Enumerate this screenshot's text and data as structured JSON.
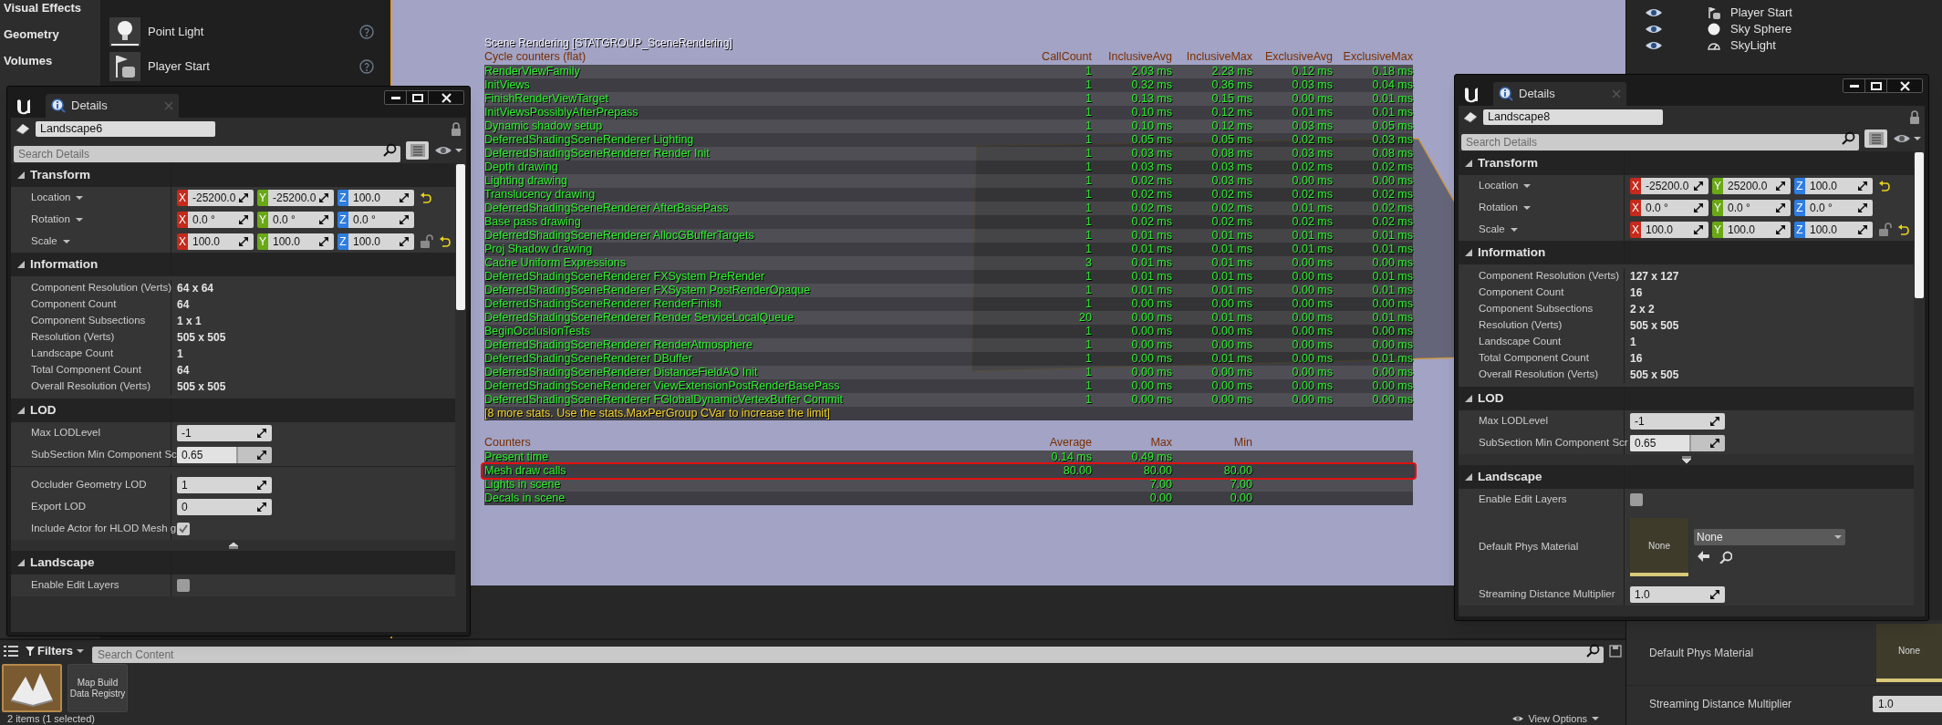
{
  "place_actors": {
    "categories": [
      {
        "label": "Visual Effects"
      },
      {
        "label": "Geometry"
      },
      {
        "label": "Volumes"
      }
    ],
    "items": [
      {
        "label": "Point Light",
        "kind": "light"
      },
      {
        "label": "Player Start",
        "kind": "player_start"
      }
    ]
  },
  "viewport": {
    "stats": {
      "title": "Scene Rendering [STATGROUP_SceneRendering]",
      "cycle_header": "Cycle counters (flat)",
      "cycle_columns": [
        "CallCount",
        "InclusiveAvg",
        "InclusiveMax",
        "ExclusiveAvg",
        "ExclusiveMax"
      ],
      "cycle_rows": [
        {
          "name": "RenderViewFamily",
          "values": [
            "1",
            "2.03 ms",
            "2.23 ms",
            "0.12 ms",
            "0.18 ms"
          ]
        },
        {
          "name": "InitViews",
          "values": [
            "1",
            "0.32 ms",
            "0.36 ms",
            "0.03 ms",
            "0.04 ms"
          ]
        },
        {
          "name": "FinishRenderViewTarget",
          "values": [
            "1",
            "0.13 ms",
            "0.15 ms",
            "0.00 ms",
            "0.01 ms"
          ]
        },
        {
          "name": "InitViewsPossiblyAfterPrepass",
          "values": [
            "1",
            "0.10 ms",
            "0.12 ms",
            "0.01 ms",
            "0.01 ms"
          ]
        },
        {
          "name": "Dynamic shadow setup",
          "values": [
            "1",
            "0.10 ms",
            "0.12 ms",
            "0.03 ms",
            "0.05 ms"
          ]
        },
        {
          "name": "DeferredShadingSceneRenderer Lighting",
          "values": [
            "1",
            "0.05 ms",
            "0.05 ms",
            "0.02 ms",
            "0.03 ms"
          ]
        },
        {
          "name": "DeferredShadingSceneRenderer Render Init",
          "values": [
            "1",
            "0.03 ms",
            "0.08 ms",
            "0.03 ms",
            "0.08 ms"
          ]
        },
        {
          "name": "Depth drawing",
          "values": [
            "1",
            "0.03 ms",
            "0.03 ms",
            "0.02 ms",
            "0.02 ms"
          ]
        },
        {
          "name": "Lighting drawing",
          "values": [
            "1",
            "0.02 ms",
            "0.03 ms",
            "0.00 ms",
            "0.00 ms"
          ]
        },
        {
          "name": "Translucency drawing",
          "values": [
            "1",
            "0.02 ms",
            "0.02 ms",
            "0.02 ms",
            "0.02 ms"
          ]
        },
        {
          "name": "DeferredShadingSceneRenderer AfterBasePass",
          "values": [
            "1",
            "0.02 ms",
            "0.02 ms",
            "0.01 ms",
            "0.02 ms"
          ]
        },
        {
          "name": "Base pass drawing",
          "values": [
            "1",
            "0.02 ms",
            "0.02 ms",
            "0.02 ms",
            "0.02 ms"
          ]
        },
        {
          "name": "DeferredShadingSceneRenderer AllocGBufferTargets",
          "values": [
            "1",
            "0.01 ms",
            "0.01 ms",
            "0.01 ms",
            "0.01 ms"
          ]
        },
        {
          "name": "Proj Shadow drawing",
          "values": [
            "1",
            "0.01 ms",
            "0.01 ms",
            "0.01 ms",
            "0.01 ms"
          ]
        },
        {
          "name": "Cache Uniform Expressions",
          "values": [
            "3",
            "0.01 ms",
            "0.01 ms",
            "0.00 ms",
            "0.00 ms"
          ]
        },
        {
          "name": "DeferredShadingSceneRenderer FXSystem PreRender",
          "values": [
            "1",
            "0.01 ms",
            "0.01 ms",
            "0.00 ms",
            "0.01 ms"
          ]
        },
        {
          "name": "DeferredShadingSceneRenderer FXSystem PostRenderOpaque",
          "values": [
            "1",
            "0.01 ms",
            "0.01 ms",
            "0.00 ms",
            "0.01 ms"
          ]
        },
        {
          "name": "DeferredShadingSceneRenderer RenderFinish",
          "values": [
            "1",
            "0.00 ms",
            "0.00 ms",
            "0.00 ms",
            "0.00 ms"
          ]
        },
        {
          "name": "DeferredShadingSceneRenderer Render ServiceLocalQueue",
          "values": [
            "20",
            "0.00 ms",
            "0.01 ms",
            "0.00 ms",
            "0.01 ms"
          ]
        },
        {
          "name": "BeginOcclusionTests",
          "values": [
            "1",
            "0.00 ms",
            "0.00 ms",
            "0.00 ms",
            "0.00 ms"
          ]
        },
        {
          "name": "DeferredShadingSceneRenderer RenderAtmosphere",
          "values": [
            "1",
            "0.00 ms",
            "0.00 ms",
            "0.00 ms",
            "0.00 ms"
          ]
        },
        {
          "name": "DeferredShadingSceneRenderer DBuffer",
          "values": [
            "1",
            "0.00 ms",
            "0.01 ms",
            "0.00 ms",
            "0.01 ms"
          ]
        },
        {
          "name": "DeferredShadingSceneRenderer DistanceFieldAO Init",
          "values": [
            "1",
            "0.00 ms",
            "0.00 ms",
            "0.00 ms",
            "0.00 ms"
          ]
        },
        {
          "name": "DeferredShadingSceneRenderer ViewExtensionPostRenderBasePass",
          "values": [
            "1",
            "0.00 ms",
            "0.00 ms",
            "0.00 ms",
            "0.00 ms"
          ]
        },
        {
          "name": "DeferredShadingSceneRenderer FGlobalDynamicVertexBuffer Commit",
          "values": [
            "1",
            "0.00 ms",
            "0.00 ms",
            "0.00 ms",
            "0.00 ms"
          ]
        }
      ],
      "more_note": "[8 more stats. Use the stats.MaxPerGroup CVar to increase the limit]",
      "counters_header": "Counters",
      "counter_columns": [
        "Average",
        "Max",
        "Min"
      ],
      "counter_rows": [
        {
          "name": "Present time",
          "average": "0.14 ms",
          "max": "0.49 ms",
          "highlighted": false
        },
        {
          "name": "Mesh draw calls",
          "average": "80.00",
          "max": "80.00",
          "min": "80.00",
          "highlighted": true
        },
        {
          "name": "Lights in scene",
          "max": "7.00",
          "min": "7.00",
          "highlighted": false
        },
        {
          "name": "Decals in scene",
          "max": "0.00",
          "min": "0.00",
          "highlighted": false
        }
      ]
    }
  },
  "details_windows": [
    {
      "tab": "Details",
      "object_name": "Landscape6",
      "search_placeholder": "Search Details",
      "sections": [
        {
          "title": "Transform",
          "expanded": true,
          "rows": [
            {
              "kind": "vector",
              "label": "Location",
              "reset": true,
              "components": [
                {
                  "axis": "X",
                  "value": "-25200.0",
                  "color": "#c52a1c"
                },
                {
                  "axis": "Y",
                  "value": "-25200.0",
                  "color": "#6aa816"
                },
                {
                  "axis": "Z",
                  "value": "100.0",
                  "color": "#2f7de0"
                }
              ]
            },
            {
              "kind": "vector",
              "label": "Rotation",
              "reset": false,
              "components": [
                {
                  "axis": "X",
                  "value": "0.0 °",
                  "color": "#c52a1c"
                },
                {
                  "axis": "Y",
                  "value": "0.0 °",
                  "color": "#6aa816"
                },
                {
                  "axis": "Z",
                  "value": "0.0 °",
                  "color": "#2f7de0"
                }
              ]
            },
            {
              "kind": "vector",
              "label": "Scale",
              "reset": true,
              "locked": false,
              "components": [
                {
                  "axis": "X",
                  "value": "100.0",
                  "color": "#c52a1c"
                },
                {
                  "axis": "Y",
                  "value": "100.0",
                  "color": "#6aa816"
                },
                {
                  "axis": "Z",
                  "value": "100.0",
                  "color": "#2f7de0"
                }
              ]
            }
          ]
        },
        {
          "title": "Information",
          "expanded": true,
          "rows": [
            {
              "kind": "info",
              "label": "Component Resolution (Verts)",
              "value": "64 x 64"
            },
            {
              "kind": "info",
              "label": "Component Count",
              "value": "64"
            },
            {
              "kind": "info",
              "label": "Component Subsections",
              "value": "1 x 1"
            },
            {
              "kind": "info",
              "label": "Resolution (Verts)",
              "value": "505 x 505"
            },
            {
              "kind": "info",
              "label": "Landscape Count",
              "value": "1"
            },
            {
              "kind": "info",
              "label": "Total Component Count",
              "value": "64"
            },
            {
              "kind": "info",
              "label": "Overall Resolution (Verts)",
              "value": "505 x 505"
            }
          ]
        },
        {
          "title": "LOD",
          "expanded": true,
          "rows": [
            {
              "kind": "number",
              "label": "Max LODLevel",
              "value": "-1"
            },
            {
              "kind": "slider",
              "label": "SubSection Min Component Sc",
              "value": "0.65",
              "level": 0.64
            }
          ],
          "advanced": {
            "expanded": true,
            "rows": [
              {
                "kind": "number",
                "label": "Occluder Geometry LOD",
                "value": "1"
              },
              {
                "kind": "number",
                "label": "Export LOD",
                "value": "0"
              },
              {
                "kind": "checkbox",
                "label": "Include Actor for HLOD Mesh g",
                "checked": true
              }
            ]
          }
        },
        {
          "title": "Landscape",
          "expanded": true,
          "rows": [
            {
              "kind": "checkbox",
              "label": "Enable Edit Layers",
              "checked": false
            }
          ]
        }
      ]
    },
    {
      "tab": "Details",
      "object_name": "Landscape8",
      "search_placeholder": "Search Details",
      "sections": [
        {
          "title": "Transform",
          "expanded": true,
          "rows": [
            {
              "kind": "vector",
              "label": "Location",
              "reset": true,
              "components": [
                {
                  "axis": "X",
                  "value": "-25200.0",
                  "color": "#c52a1c"
                },
                {
                  "axis": "Y",
                  "value": "25200.0",
                  "color": "#6aa816"
                },
                {
                  "axis": "Z",
                  "value": "100.0",
                  "color": "#2f7de0"
                }
              ]
            },
            {
              "kind": "vector",
              "label": "Rotation",
              "reset": false,
              "components": [
                {
                  "axis": "X",
                  "value": "0.0 °",
                  "color": "#c52a1c"
                },
                {
                  "axis": "Y",
                  "value": "0.0 °",
                  "color": "#6aa816"
                },
                {
                  "axis": "Z",
                  "value": "0.0 °",
                  "color": "#2f7de0"
                }
              ]
            },
            {
              "kind": "vector",
              "label": "Scale",
              "reset": true,
              "locked": false,
              "components": [
                {
                  "axis": "X",
                  "value": "100.0",
                  "color": "#c52a1c"
                },
                {
                  "axis": "Y",
                  "value": "100.0",
                  "color": "#6aa816"
                },
                {
                  "axis": "Z",
                  "value": "100.0",
                  "color": "#2f7de0"
                }
              ]
            }
          ]
        },
        {
          "title": "Information",
          "expanded": true,
          "rows": [
            {
              "kind": "info",
              "label": "Component Resolution (Verts)",
              "value": "127 x 127"
            },
            {
              "kind": "info",
              "label": "Component Count",
              "value": "16"
            },
            {
              "kind": "info",
              "label": "Component Subsections",
              "value": "2 x 2"
            },
            {
              "kind": "info",
              "label": "Resolution (Verts)",
              "value": "505 x 505"
            },
            {
              "kind": "info",
              "label": "Landscape Count",
              "value": "1"
            },
            {
              "kind": "info",
              "label": "Total Component Count",
              "value": "16"
            },
            {
              "kind": "info",
              "label": "Overall Resolution (Verts)",
              "value": "505 x 505"
            }
          ]
        },
        {
          "title": "LOD",
          "expanded": true,
          "rows": [
            {
              "kind": "number",
              "label": "Max LODLevel",
              "value": "-1"
            },
            {
              "kind": "slider",
              "label": "SubSection Min Component Scr",
              "value": "0.65",
              "level": 0.64
            }
          ],
          "advanced": {
            "expanded": false
          }
        },
        {
          "title": "Landscape",
          "expanded": true,
          "rows": [
            {
              "kind": "checkbox",
              "label": "Enable Edit Layers",
              "checked": false
            },
            {
              "kind": "material",
              "label": "Default Phys Material",
              "thumbnail": "None",
              "value": "None"
            },
            {
              "kind": "number",
              "label": "Streaming Distance Multiplier",
              "value": "1.0"
            }
          ]
        }
      ]
    }
  ],
  "outliner": {
    "items": [
      {
        "label": "Player Start",
        "kind": "player_start",
        "visible": true
      },
      {
        "label": "Sky Sphere",
        "kind": "sky_sphere",
        "visible": true
      },
      {
        "label": "SkyLight",
        "kind": "sky_light",
        "visible": true
      }
    ]
  },
  "background_details": {
    "rows": [
      {
        "kind": "material",
        "label": "Default Phys Material",
        "thumbnail": "None"
      },
      {
        "kind": "number",
        "label": "Streaming Distance Multiplier",
        "value": "1.0"
      }
    ]
  },
  "content_browser": {
    "filters": "Filters",
    "search_placeholder": "Search Content",
    "assets": [
      {
        "kind": "landscape",
        "selected": true
      },
      {
        "kind": "registry",
        "label": "Map Build Data Registry",
        "selected": false
      }
    ],
    "status": "2 items (1 selected)",
    "view_options": "View Options"
  }
}
